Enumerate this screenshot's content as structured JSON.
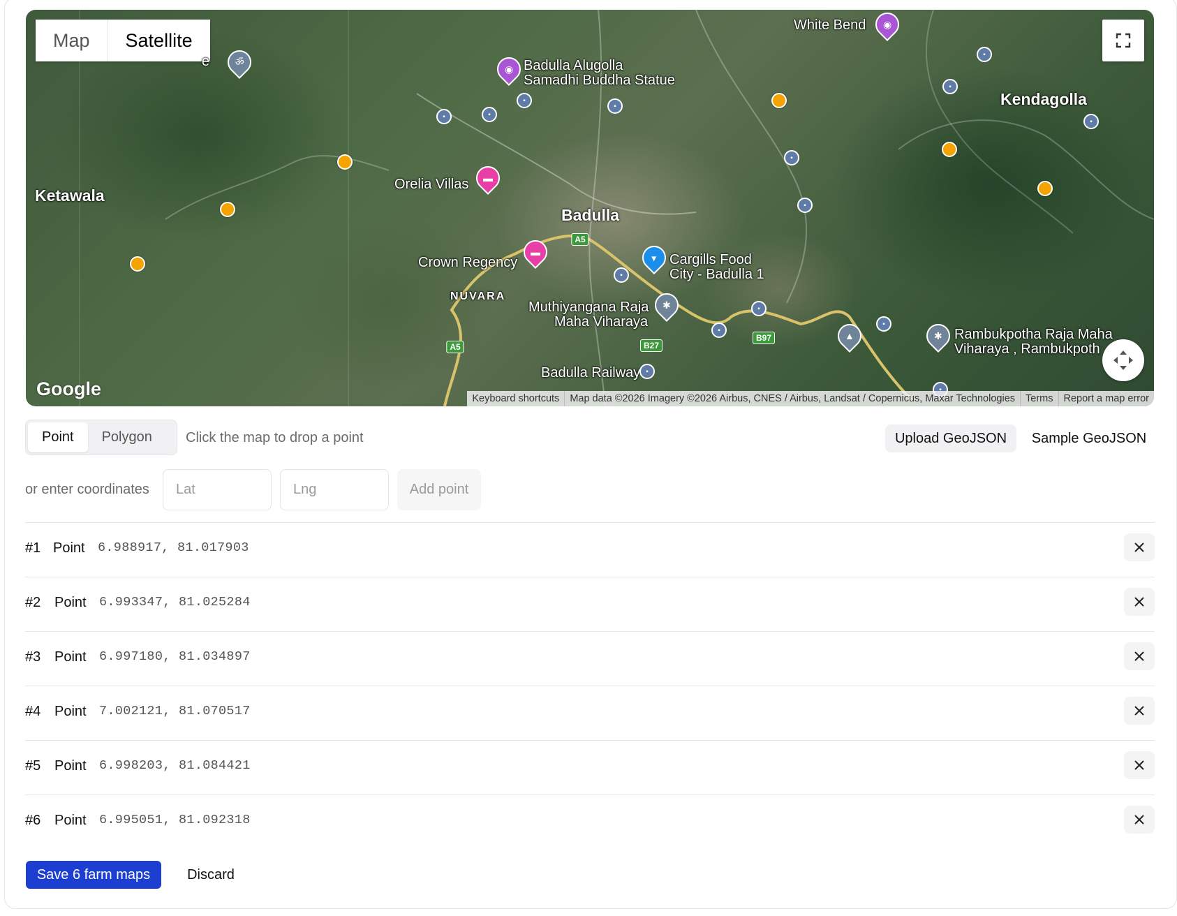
{
  "map": {
    "type_options": [
      "Map",
      "Satellite"
    ],
    "active_type": "Satellite",
    "logo": "Google",
    "attribution": [
      "Keyboard shortcuts",
      "Map data ©2026 Imagery ©2026 Airbus, CNES / Airbus, Landsat / Copernicus, Maxar Technologies",
      "Terms",
      "Report a map error"
    ],
    "labels": {
      "white_bend": "White Bend",
      "alugolla_1": "Badulla Alugolla",
      "alugolla_2": "Samadhi Buddha Statue",
      "kendagolla": "Kendagolla",
      "ketawala": "Ketawala",
      "orelia": "Orelia Villas",
      "badulla": "Badulla",
      "crown": "Crown Regency",
      "cargills_1": "Cargills Food",
      "cargills_2": "City - Badulla 1",
      "nuvara": "NUVARA",
      "muthiyangana_1": "Muthiyangana Raja",
      "muthiyangana_2": "Maha Viharaya",
      "rambukpotha_1": "Rambukpotha Raja Maha",
      "rambukpotha_2": "Viharaya , Rambukpoth",
      "railway": "Badulla Railway",
      "ghost": "e"
    },
    "shields": {
      "a5_top": "A5",
      "a5_left": "A5",
      "b27": "B27",
      "b97": "B97"
    },
    "icons": [
      "fullscreen-icon",
      "move-icon",
      "bus-stop-icon",
      "camera-icon",
      "hotel-icon",
      "shopping-cart-icon",
      "temple-icon",
      "school-icon",
      "om-icon"
    ]
  },
  "toolbar": {
    "modes": [
      "Point",
      "Polygon"
    ],
    "active_mode": "Point",
    "hint": "Click the map to drop a point",
    "upload_label": "Upload GeoJSON",
    "sample_label": "Sample GeoJSON"
  },
  "coords_entry": {
    "label": "or enter coordinates",
    "lat_placeholder": "Lat",
    "lng_placeholder": "Lng",
    "add_label": "Add point"
  },
  "points": [
    {
      "index": "#1",
      "kind": "Point",
      "coords": "6.988917, 81.017903"
    },
    {
      "index": "#2",
      "kind": "Point",
      "coords": "6.993347, 81.025284"
    },
    {
      "index": "#3",
      "kind": "Point",
      "coords": "6.997180, 81.034897"
    },
    {
      "index": "#4",
      "kind": "Point",
      "coords": "7.002121, 81.070517"
    },
    {
      "index": "#5",
      "kind": "Point",
      "coords": "6.998203, 81.084421"
    },
    {
      "index": "#6",
      "kind": "Point",
      "coords": "6.995051, 81.092318"
    }
  ],
  "footer": {
    "save_label": "Save 6 farm maps",
    "discard_label": "Discard"
  },
  "colors": {
    "marker": "#f5a300",
    "primary": "#1d3fd1"
  }
}
